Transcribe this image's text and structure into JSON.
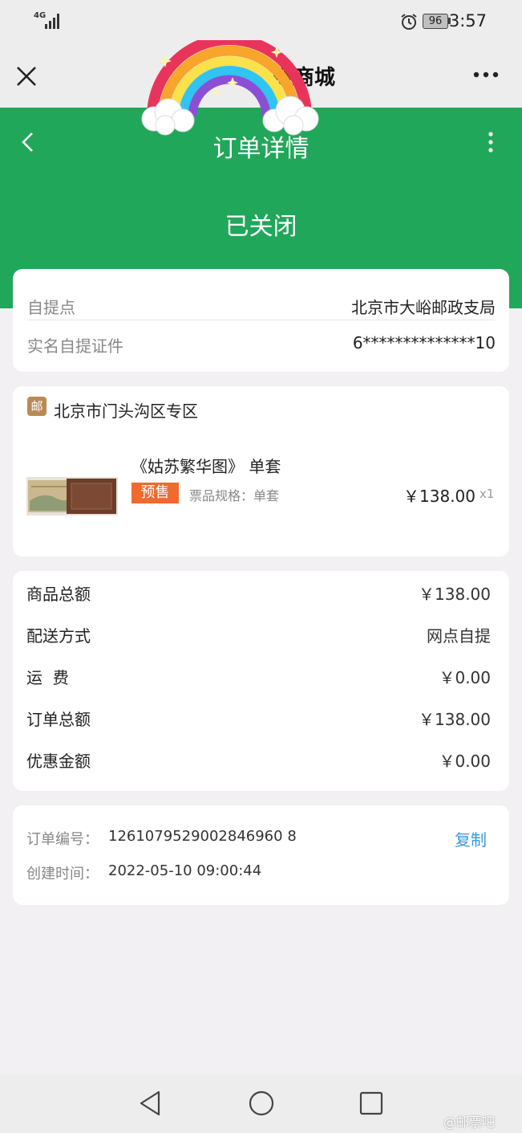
{
  "status_bar": {
    "network": "4G",
    "battery": "96",
    "time": "3:57"
  },
  "titlebar": {
    "title": "微商城"
  },
  "header": {
    "title": "订单详情",
    "order_status": "已关闭",
    "colors": {
      "accent": "#21a75a"
    }
  },
  "pickup": {
    "point_label": "自提点",
    "point_value": "北京市大峪邮政支局",
    "id_label": "实名自提证件",
    "id_value": "6**************10"
  },
  "store": {
    "icon_char": "邮",
    "name": "北京市门头沟区专区"
  },
  "product": {
    "title": "《姑苏繁华图》 单套",
    "tag": "预售",
    "spec": "票品规格：单套",
    "price": "￥138.00",
    "qty": "x1"
  },
  "summary": {
    "rows": [
      {
        "label": "商品总额",
        "value": "￥138.00"
      },
      {
        "label": "配送方式",
        "value": "网点自提"
      },
      {
        "label": "运  费",
        "value": "￥0.00"
      },
      {
        "label": "订单总额",
        "value": "￥138.00"
      },
      {
        "label": "优惠金额",
        "value": "￥0.00"
      }
    ]
  },
  "order": {
    "number_label": "订单编号：",
    "number": "1261079529002846960 8",
    "copy_label": "复制",
    "time_label": "创建时间：",
    "time": "2022-05-10 09:00:44"
  },
  "watermark": "@邮票吧"
}
